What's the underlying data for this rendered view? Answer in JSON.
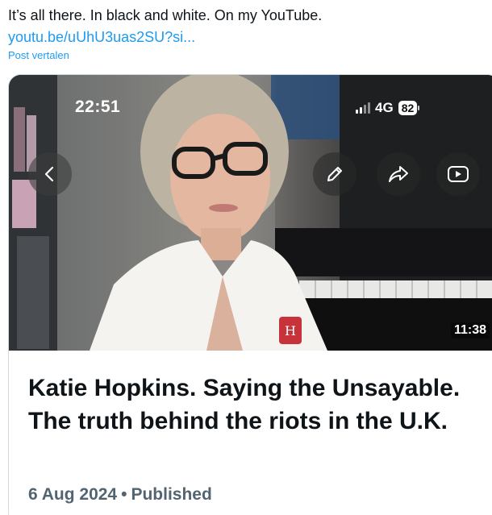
{
  "tweet": {
    "text": "It’s all there. In black and white. On my YouTube.",
    "link": "youtu.be/uUhU3uas2SU?si...",
    "translate_label": "Post vertalen"
  },
  "card": {
    "status_bar": {
      "time": "22:51",
      "network": "4G",
      "battery": "82"
    },
    "buttons": {
      "back": "chevron-left-icon",
      "edit": "pencil-icon",
      "share": "share-arrow-icon",
      "youtube": "play-icon"
    },
    "duration": "11:38",
    "title": "Katie Hopkins. Saying the Unsayable. The truth behind the riots in the U.K.",
    "date": "6 Aug 2024",
    "separator": "•",
    "status": "Published"
  },
  "colors": {
    "link": "#1d9bf0",
    "text": "#0f1419",
    "meta": "#536471",
    "border": "#cfd9de"
  }
}
